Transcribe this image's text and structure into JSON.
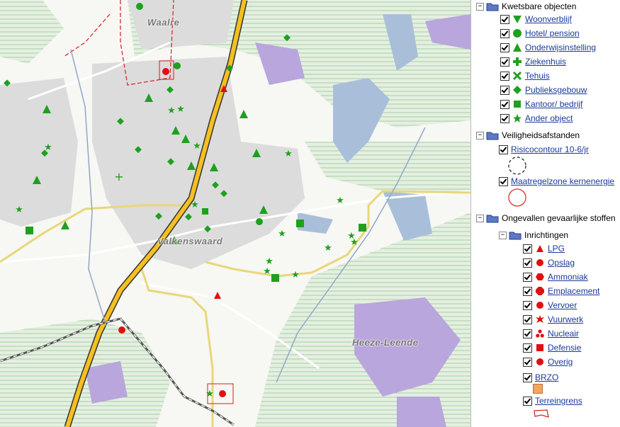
{
  "map": {
    "places": {
      "waalre": "Waalre",
      "valkenswaard": "Valkenswaard",
      "heeze": "Heeze-Leende"
    }
  },
  "legend": {
    "kwetsbaar": {
      "title": "Kwetsbare objecten",
      "items": [
        "Woonverblijf",
        "Hotel/ pension",
        "Onderwijsinstelling",
        "Ziekenhuis",
        "Tehuis",
        "Publieksgebouw",
        "Kantoor/ bedrijf",
        "Ander object"
      ]
    },
    "veiligheid": {
      "title": "Veiligheidsafstanden",
      "items": [
        "Risicocontour 10-6/jr",
        "Maatregelzone kernenergie"
      ]
    },
    "ongevallen": {
      "title": "Ongevallen gevaarlijke stoffen",
      "inrichtingen": "Inrichtingen",
      "items": [
        "LPG",
        "Opslag",
        "Ammoniak",
        "Emplacement",
        "Vervoer",
        "Vuurwerk",
        "Nucleair",
        "Defensie",
        "Overig"
      ],
      "brzo": "BRZO",
      "terreingrens": "Terreingrens"
    }
  },
  "colors": {
    "green": "#1fa01f",
    "red": "#e01010",
    "road": "#f5c020",
    "water": "#a8bfd8",
    "forest": "#c9dcc5",
    "heath": "#b8a8d8",
    "urban": "#d9d9d9"
  }
}
